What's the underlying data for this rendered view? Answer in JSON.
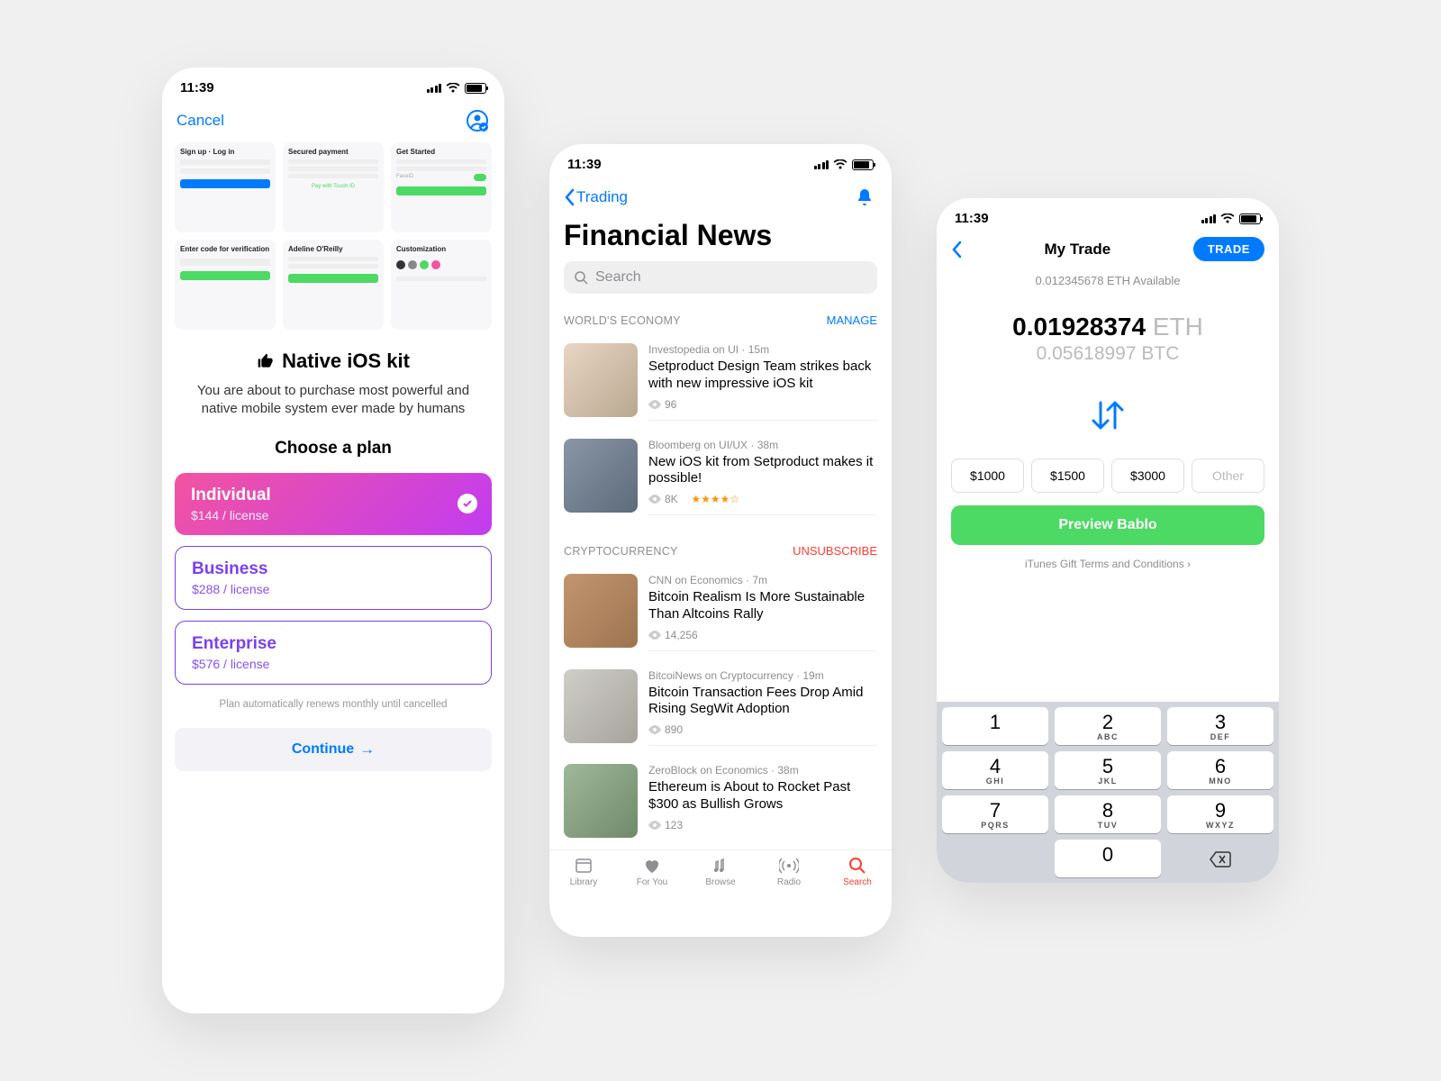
{
  "status": {
    "time": "11:39"
  },
  "phone1": {
    "cancel": "Cancel",
    "title": "Native iOS kit",
    "desc": "You are about to purchase most powerful and native mobile system ever made by humans",
    "choose": "Choose a plan",
    "plans": [
      {
        "name": "Individual",
        "price": "$144 / license"
      },
      {
        "name": "Business",
        "price": "$288 / license"
      },
      {
        "name": "Enterprise",
        "price": "$576 / license"
      }
    ],
    "footer": "Plan automatically renews monthly until cancelled",
    "continue": "Continue",
    "previews": [
      "Sign up · Log in",
      "Secured payment",
      "Get Started",
      "Enter code for verification",
      "Adeline O'Reilly",
      "Customization"
    ]
  },
  "phone2": {
    "back": "Trading",
    "title": "Financial News",
    "search_placeholder": "Search",
    "sections": [
      {
        "label": "WORLD'S ECONOMY",
        "action": "MANAGE"
      },
      {
        "label": "CRYPTOCURRENCY",
        "action": "UNSUBSCRIBE"
      }
    ],
    "news": [
      {
        "meta": "Investopedia on UI · 15m",
        "title": "Setproduct Design Team strikes back with new impressive iOS kit",
        "views": "96",
        "rating": ""
      },
      {
        "meta": "Bloomberg on UI/UX · 38m",
        "title": "New iOS kit from Setproduct makes it possible!",
        "views": "8K",
        "rating": "★★★★☆"
      },
      {
        "meta": "CNN on Economics · 7m",
        "title": "Bitcoin Realism Is More Sustainable Than Altcoins Rally",
        "views": "14,256",
        "rating": ""
      },
      {
        "meta": "BitcoiNews on Cryptocurrency · 19m",
        "title": "Bitcoin Transaction Fees Drop Amid Rising SegWit Adoption",
        "views": "890",
        "rating": ""
      },
      {
        "meta": "ZeroBlock on Economics · 38m",
        "title": "Ethereum is About to Rocket Past $300 as Bullish Grows",
        "views": "123",
        "rating": ""
      }
    ],
    "tabs": [
      "Library",
      "For You",
      "Browse",
      "Radio",
      "Search"
    ]
  },
  "phone3": {
    "title": "My Trade",
    "trade_btn": "TRADE",
    "available": "0.012345678 ETH Available",
    "primary_amount": "0.01928374",
    "primary_unit": "ETH",
    "secondary": "0.05618997 BTC",
    "chips": [
      "$1000",
      "$1500",
      "$3000",
      "Other"
    ],
    "preview": "Preview Bablo",
    "terms": "iTunes Gift Terms and Conditions",
    "keypad": [
      {
        "n": "1",
        "s": ""
      },
      {
        "n": "2",
        "s": "ABC"
      },
      {
        "n": "3",
        "s": "DEF"
      },
      {
        "n": "4",
        "s": "GHI"
      },
      {
        "n": "5",
        "s": "JKL"
      },
      {
        "n": "6",
        "s": "MNO"
      },
      {
        "n": "7",
        "s": "PQRS"
      },
      {
        "n": "8",
        "s": "TUV"
      },
      {
        "n": "9",
        "s": "WXYZ"
      },
      {
        "n": "",
        "s": ""
      },
      {
        "n": "0",
        "s": ""
      },
      {
        "n": "⌫",
        "s": ""
      }
    ]
  }
}
